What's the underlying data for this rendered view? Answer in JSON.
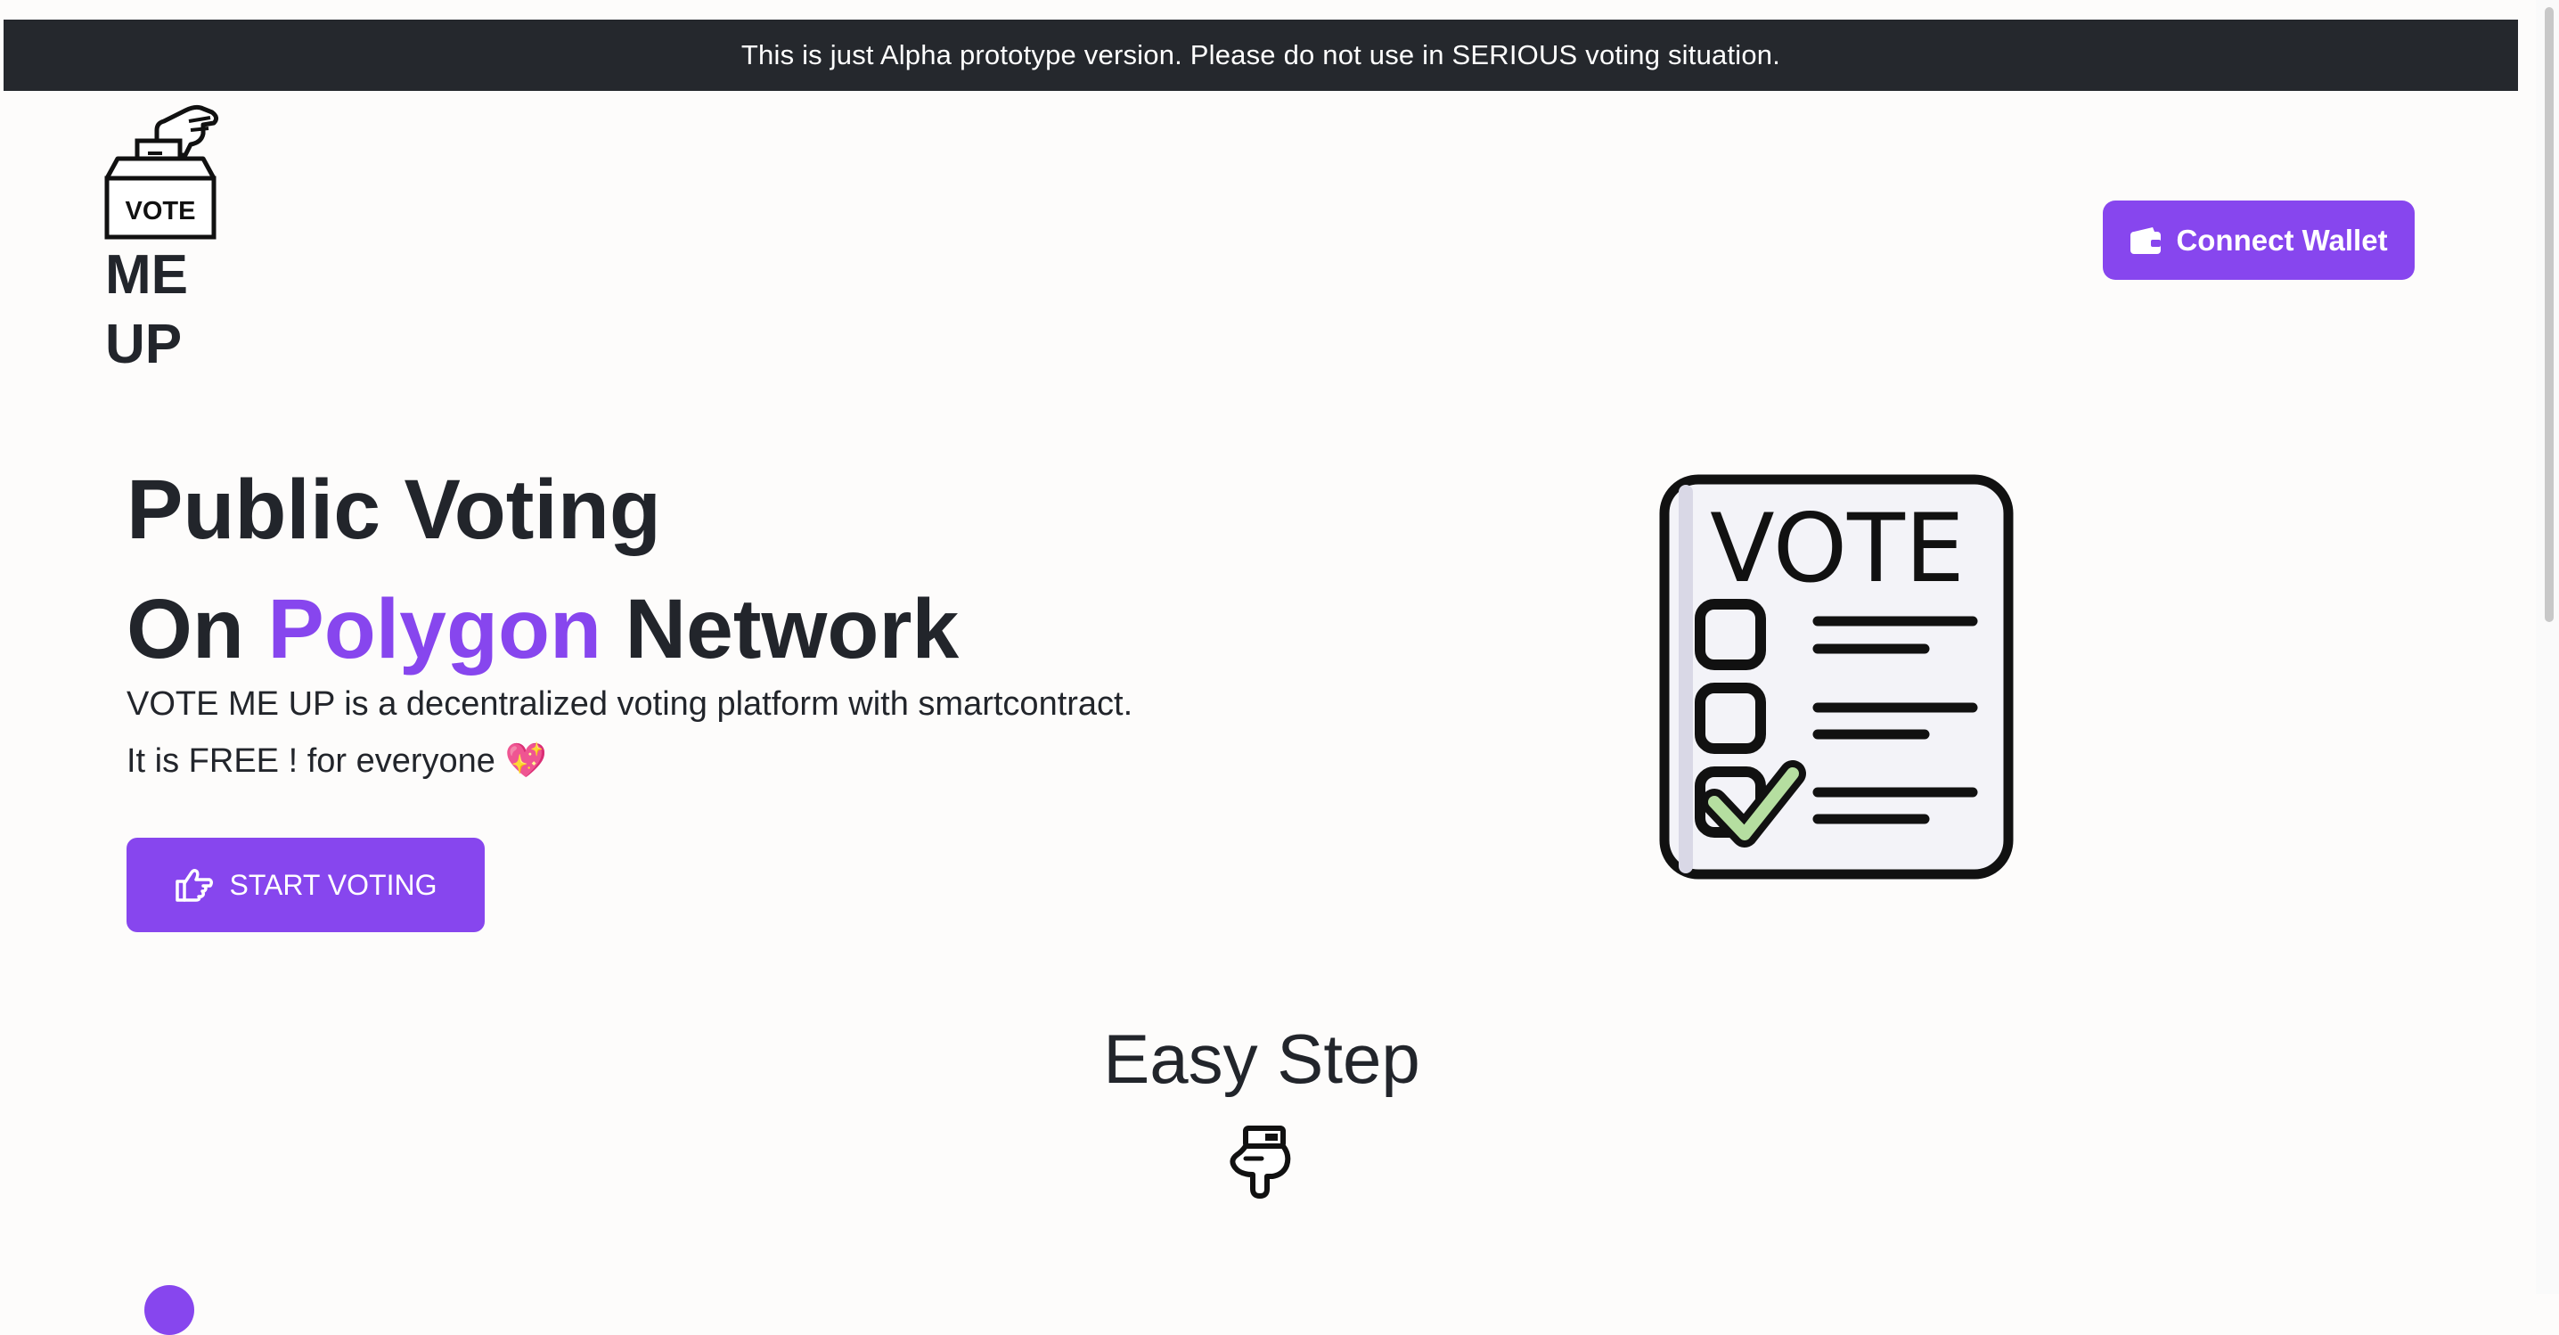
{
  "banner": {
    "text": "This is just Alpha prototype version. Please do not use in SERIOUS voting situation."
  },
  "logo": {
    "box_label": "VOTE",
    "line1": "ME",
    "line2": "UP"
  },
  "header": {
    "connect_wallet_label": "Connect Wallet"
  },
  "hero": {
    "title_line1": "Public Voting",
    "title_line2_prefix": "On ",
    "title_line2_accent": "Polygon",
    "title_line2_suffix": " Network",
    "description_line1": "VOTE ME UP is a decentralized voting platform with smartcontract.",
    "description_line2": "It is FREE ! for everyone",
    "description_emoji": "💖",
    "start_button_label": "START VOTING",
    "illustration_label": "VOTE"
  },
  "section": {
    "easy_step_title": "Easy Step"
  },
  "colors": {
    "accent": "#8746ee",
    "banner_bg": "#25282d",
    "text": "#22252b",
    "background": "#fdfcfb"
  },
  "icons": [
    "ballot-box-logo-icon",
    "wallet-icon",
    "pointing-hand-right-icon",
    "vote-checklist-icon",
    "pointing-hand-down-icon"
  ]
}
